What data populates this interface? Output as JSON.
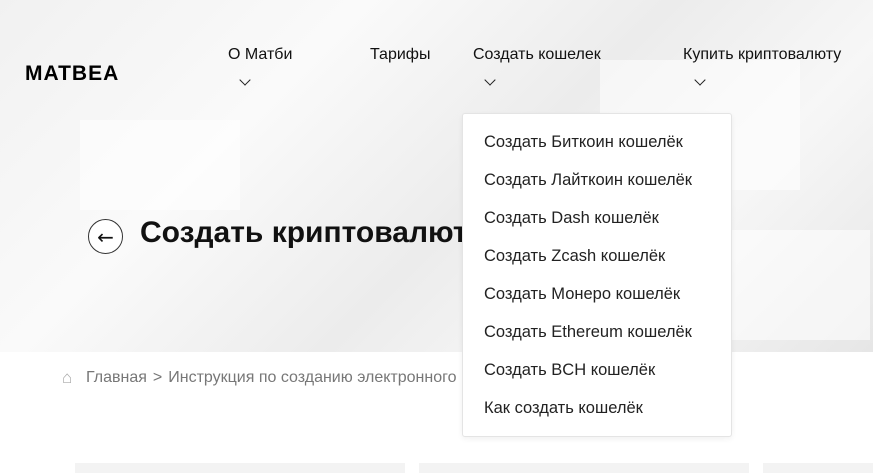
{
  "logo": "MATBEA",
  "nav": [
    "О Матби",
    "Тарифы",
    "Создать кошелек",
    "Купить криптовалюту"
  ],
  "page_title": "Создать криптовалюту",
  "breadcrumbs": {
    "home": "Главная",
    "separator": ">",
    "current": "Инструкция по созданию электронного кошелька"
  },
  "dropdown": [
    "Создать Биткоин кошелёк",
    "Создать Лайткоин кошелёк",
    "Создать Dash кошелёк",
    "Создать Zcash кошелёк",
    "Создать Монеро кошелёк",
    "Создать Ethereum кошелёк",
    "Создать BCH кошелёк",
    "Как создать кошелёк"
  ]
}
